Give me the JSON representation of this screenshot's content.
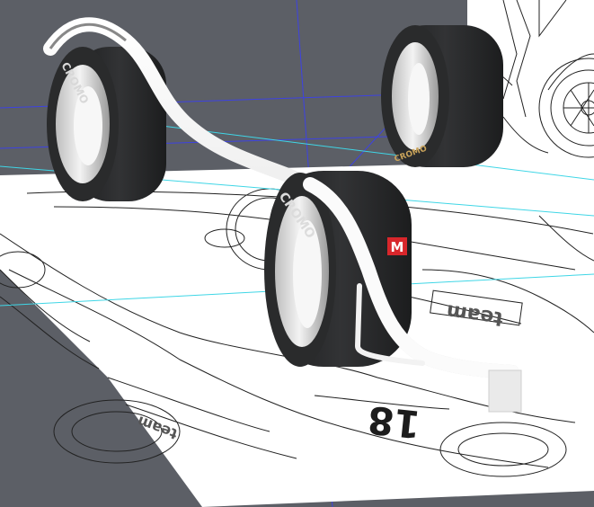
{
  "viewport": {
    "background_color": "#5c5f66",
    "grid_color": "#3a3ff0",
    "grid_accent_color": "#3fd6e6",
    "blueprint_paper_color": "#ffffff"
  },
  "tires": {
    "brand_label": "CROMO",
    "rim_color": "#e6e6e6",
    "rubber_color": "#262728"
  },
  "badge": {
    "letter": "M",
    "color": "#d8262b"
  },
  "blueprint": {
    "car_number": "18",
    "sponsor_text": "team"
  }
}
